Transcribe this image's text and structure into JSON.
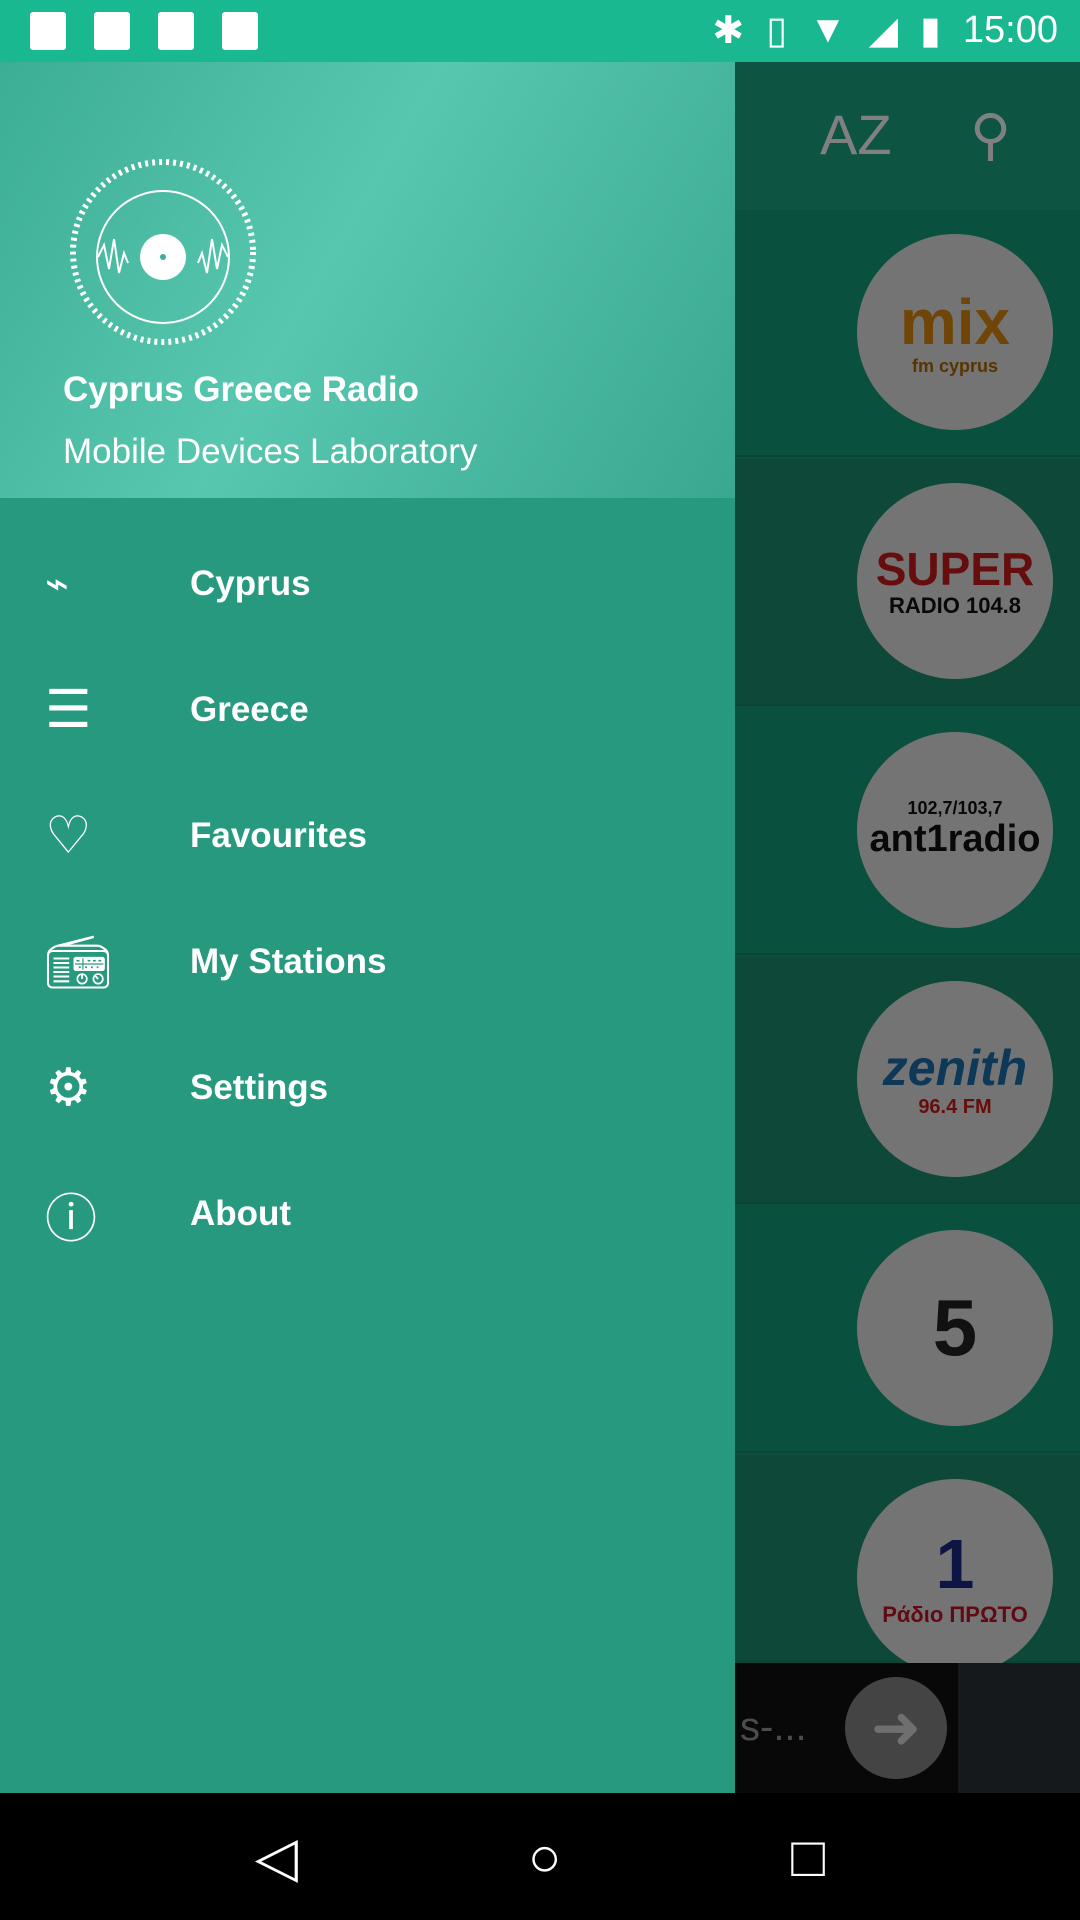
{
  "status_bar": {
    "time": "15:00",
    "left_icons": [
      "image-icon",
      "n-icon",
      "download-icon",
      "play-store-icon"
    ],
    "right_icons": [
      "bluetooth-icon",
      "vibrate-icon",
      "wifi-icon",
      "no-signal-icon",
      "battery-charging-icon"
    ]
  },
  "toolbar": {
    "sort_icon": "AZ",
    "search_icon": "search"
  },
  "stations": [
    {
      "logo": "mix",
      "sub": "fm cyprus",
      "color": "#e08a10"
    },
    {
      "logo": "SUPER",
      "sub": "RADIO 104.8",
      "color": "#cc1a1a"
    },
    {
      "logo": "ant1radio",
      "sub": "102,7/103,7",
      "color": "#111111"
    },
    {
      "logo": "zenith",
      "sub": "96.4 FM",
      "color": "#1a6fb0"
    },
    {
      "logo": "5",
      "sub": "",
      "color": "#222222"
    },
    {
      "logo": "1",
      "sub": "Ράδιο ΠΡΩΤΟ",
      "color": "#1a2a8a"
    }
  ],
  "ad": {
    "text": "s-..."
  },
  "drawer": {
    "title": "Cyprus Greece Radio",
    "subtitle": "Mobile Devices Laboratory",
    "items": [
      {
        "label": "Cyprus",
        "icon": "cyprus-map-icon"
      },
      {
        "label": "Greece",
        "icon": "greek-flag-icon"
      },
      {
        "label": "Favourites",
        "icon": "heart-icon"
      },
      {
        "label": "My Stations",
        "icon": "radio-icon"
      },
      {
        "label": "Settings",
        "icon": "gear-icon"
      },
      {
        "label": "About",
        "icon": "info-icon"
      }
    ]
  },
  "colors": {
    "status": "#19b890",
    "drawer": "#26997e"
  }
}
